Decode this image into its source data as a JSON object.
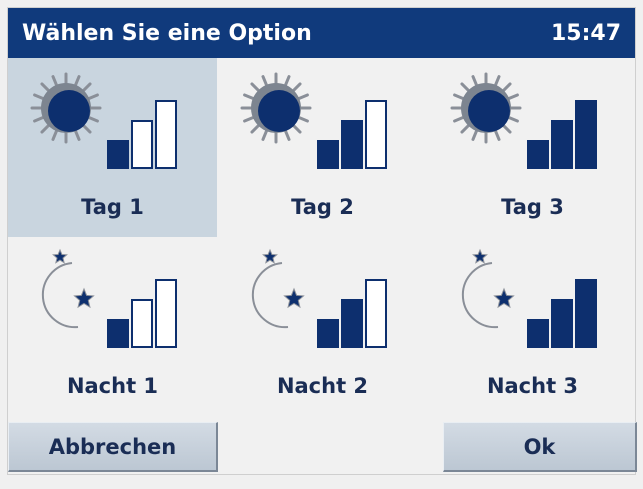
{
  "title": "Wählen Sie eine Option",
  "clock": "15:47",
  "options": [
    {
      "label": "Tag 1",
      "icon": "sun-icon",
      "level": 1,
      "selected": true
    },
    {
      "label": "Tag 2",
      "icon": "sun-icon",
      "level": 2,
      "selected": false
    },
    {
      "label": "Tag 3",
      "icon": "sun-icon",
      "level": 3,
      "selected": false
    },
    {
      "label": "Nacht 1",
      "icon": "moon-stars-icon",
      "level": 1,
      "selected": false
    },
    {
      "label": "Nacht 2",
      "icon": "moon-stars-icon",
      "level": 2,
      "selected": false
    },
    {
      "label": "Nacht 3",
      "icon": "moon-stars-icon",
      "level": 3,
      "selected": false
    }
  ],
  "buttons": {
    "cancel": "Abbrechen",
    "ok": "Ok"
  },
  "colors": {
    "titlebar": "#103a7c",
    "accent": "#0d2f6e",
    "selected": "#c9d5df",
    "text": "#1a2d55"
  }
}
